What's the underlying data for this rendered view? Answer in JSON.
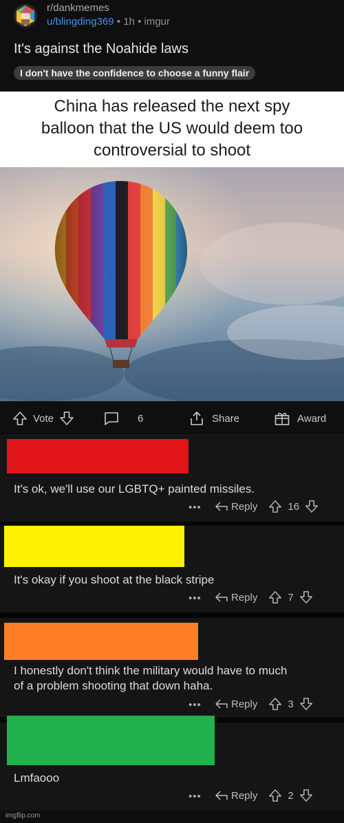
{
  "post": {
    "subreddit": "r/dankmemes",
    "username": "u/blingding369",
    "separator": "•",
    "age": "1h",
    "domain": "imgur",
    "title": "It's against the Noahide laws",
    "flair": "I don't have the confidence to choose a funny flair",
    "meme_caption": [
      "China has released the next spy",
      "balloon that the US would deem too",
      "controversial to shoot"
    ]
  },
  "actions": {
    "vote_label": "Vote",
    "comment_count": "6",
    "share_label": "Share",
    "award_label": "Award"
  },
  "comments": [
    {
      "text": "It's ok, we'll use our LGBTQ+ painted missiles.",
      "reply_label": "Reply",
      "votes": "16",
      "redaction_color": "#e0161b"
    },
    {
      "text": "It's okay if you shoot at the black stripe",
      "reply_label": "Reply",
      "votes": "7",
      "redaction_color": "#fff200"
    },
    {
      "text_lines": [
        "I honestly don't think the military would have to much",
        "of a problem shooting that down haha."
      ],
      "reply_label": "Reply",
      "votes": "3",
      "redaction_color": "#ff7f27"
    },
    {
      "text": "Lmfaooo",
      "reply_label": "Reply",
      "votes": "2",
      "redaction_color": "#22b14c"
    }
  ],
  "overflow_label": "•••",
  "watermark": "imgflip.com",
  "colors": {
    "background": "#0e0e0f",
    "comment_bg": "#151516",
    "username": "#3f93e8",
    "flair_bg": "#3c3c3d"
  }
}
